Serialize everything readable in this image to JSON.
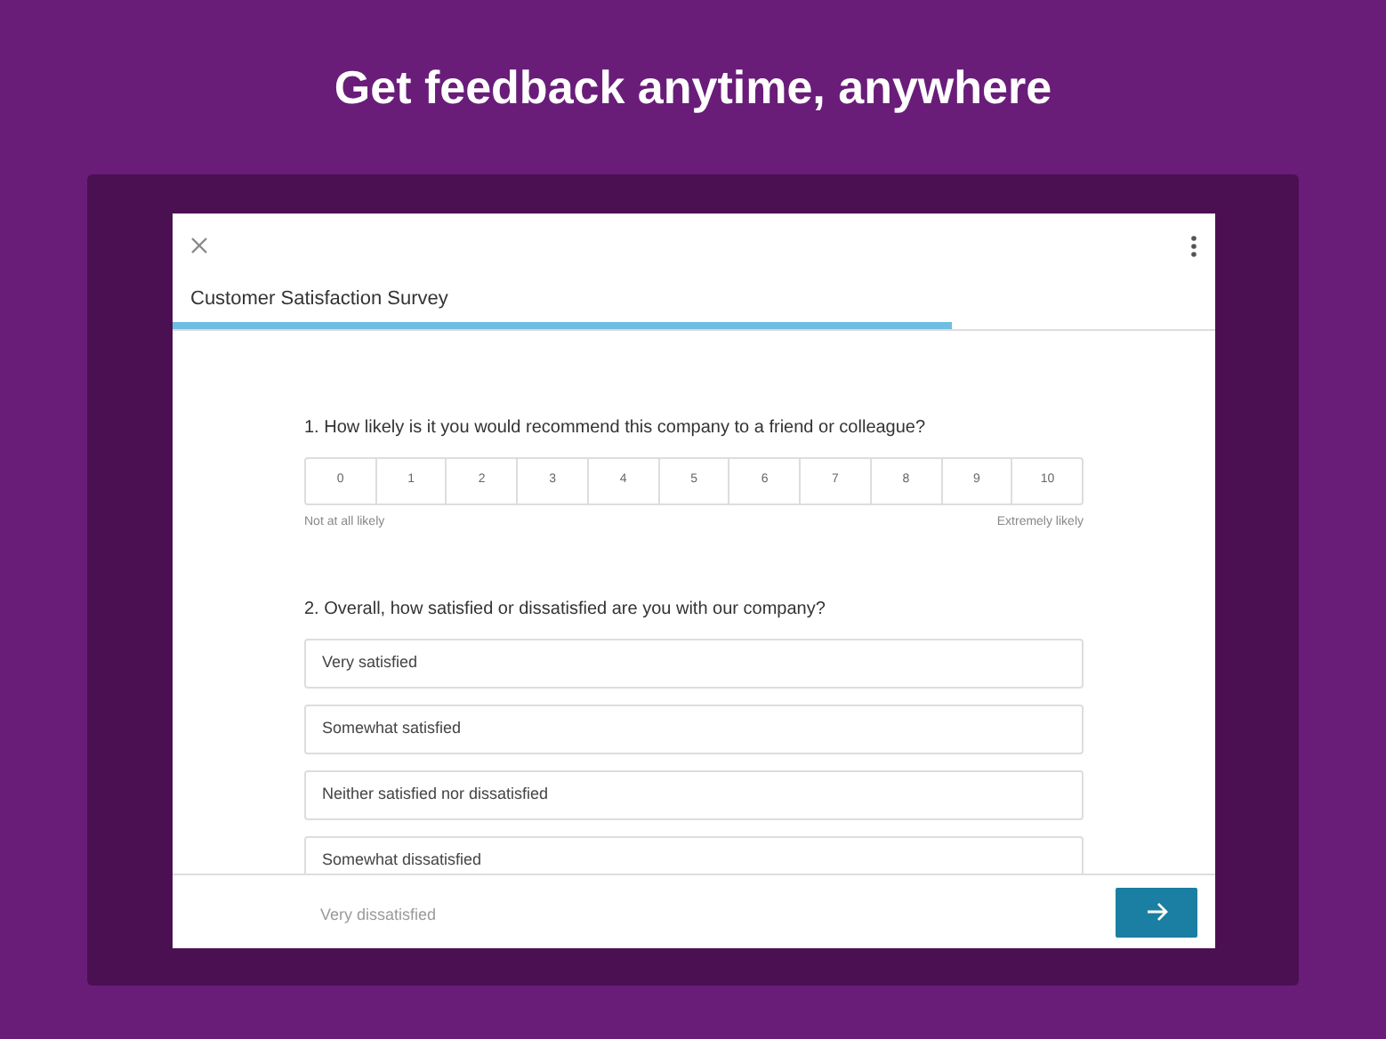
{
  "headline": "Get feedback anytime, anywhere",
  "survey": {
    "title": "Customer Satisfaction Survey",
    "progress": {
      "level": 0.747
    },
    "questions": [
      {
        "kind": "scale",
        "text": "1. How likely is it you would recommend this company to a friend or colleague?",
        "options": [
          "0",
          "1",
          "2",
          "3",
          "4",
          "5",
          "6",
          "7",
          "8",
          "9",
          "10"
        ],
        "low_label": "Not at all likely",
        "high_label": "Extremely likely"
      },
      {
        "kind": "choice",
        "text": "2. Overall, how satisfied or dissatisfied are you with our company?",
        "options": [
          {
            "label": "Very satisfied",
            "obscured": false
          },
          {
            "label": "Somewhat satisfied",
            "obscured": false
          },
          {
            "label": "Neither satisfied nor dissatisfied",
            "obscured": false
          },
          {
            "label": "Somewhat dissatisfied",
            "obscured": false
          },
          {
            "label": "Very dissatisfied",
            "obscured": true
          }
        ]
      }
    ]
  }
}
